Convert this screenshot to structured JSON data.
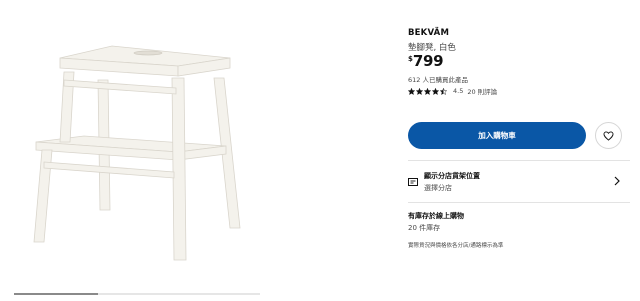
{
  "product": {
    "brand": "BEKVÄM",
    "description": "墊腳凳, 白色",
    "price_currency": "$",
    "price_amount": "799",
    "sold_text": "612 人已購買此產品",
    "rating_score": "4.5",
    "rating_count_text": "20 則評論",
    "rating_value": 4.5
  },
  "actions": {
    "add_to_cart_label": "加入購物車",
    "favorite_icon": "heart-icon"
  },
  "store": {
    "title": "顯示分店貨架位置",
    "subtitle": "選擇分店",
    "icon": "store-shelf-icon"
  },
  "stock": {
    "title": "有庫存於線上購物",
    "subtitle": "20 件庫存",
    "note": "實際貨況與價格依各分店/通路標示為準"
  },
  "gallery": {
    "progress": 0.34
  },
  "colors": {
    "accent": "#0a57a6",
    "star": "#111111"
  }
}
